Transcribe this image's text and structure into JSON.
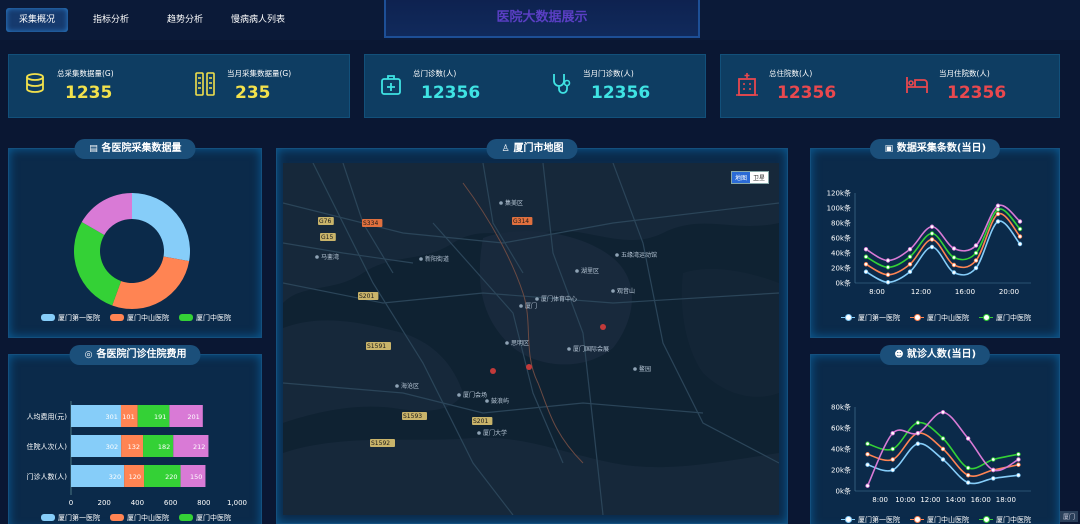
{
  "nav": {
    "tabs": [
      {
        "label": "采集概况",
        "active": true
      },
      {
        "label": "指标分析",
        "active": false
      },
      {
        "label": "趋势分析",
        "active": false
      },
      {
        "label": "慢病病人列表",
        "active": false
      }
    ],
    "title": "医院大数据展示"
  },
  "stats": [
    {
      "label": "总采集数据量(G)",
      "value": "1235",
      "color": "#f2e14c",
      "icon": "database-icon"
    },
    {
      "label": "当月采集数据量(G)",
      "value": "235",
      "color": "#f2e14c",
      "icon": "server-rack-icon"
    },
    {
      "label": "总门诊数(人)",
      "value": "12356",
      "color": "#3fe3e3",
      "icon": "medical-kit-icon"
    },
    {
      "label": "当月门诊数(人)",
      "value": "12356",
      "color": "#3fe3e3",
      "icon": "stethoscope-icon"
    },
    {
      "label": "总住院数(人)",
      "value": "12356",
      "color": "#e8484e",
      "icon": "hospital-building-icon"
    },
    {
      "label": "当月住院数(人)",
      "value": "12356",
      "color": "#e8484e",
      "icon": "hospital-bed-icon"
    }
  ],
  "panels": {
    "donut_title": "各医院采集数据量",
    "stack_title": "各医院门诊住院费用",
    "map_title": "厦门市地图",
    "collect_title": "数据采集条数(当日)",
    "visit_title": "就诊人数(当日)"
  },
  "map": {
    "toggle": [
      "地图",
      "卫星"
    ],
    "active_toggle": "地图",
    "places": [
      {
        "name": "集美区"
      },
      {
        "name": "湖里区"
      },
      {
        "name": "厦门"
      },
      {
        "name": "思明区"
      },
      {
        "name": "厦门大学"
      },
      {
        "name": "鼓浪屿"
      },
      {
        "name": "海沧区"
      },
      {
        "name": "五缘湾运动馆"
      },
      {
        "name": "观音山"
      },
      {
        "name": "厦门国际会展"
      },
      {
        "name": "鳌园"
      },
      {
        "name": "马銮湾"
      },
      {
        "name": "新阳街道"
      },
      {
        "name": "厦门体育中心"
      },
      {
        "name": "厦门会场"
      }
    ],
    "roads": [
      "G76",
      "G15",
      "S334",
      "G314",
      "S201",
      "S1591",
      "S1593",
      "S1592",
      "S201"
    ],
    "corner_tag": "厦门"
  },
  "colors": {
    "blue": "#86cdf9",
    "orange": "#ff8453",
    "green": "#34d136",
    "purple": "#d97ad6",
    "white": "#ffffff"
  },
  "chart_data": [
    {
      "type": "pie",
      "variant": "donut",
      "title": "各医院采集数据量",
      "labels": [
        "厦门第一医院",
        "厦门中山医院",
        "厦门中医院",
        ""
      ],
      "values": [
        25,
        25,
        25,
        15
      ],
      "colors": [
        "#86cdf9",
        "#ff8453",
        "#34d136",
        "#d97ad6"
      ],
      "legend": [
        "厦门第一医院",
        "厦门中山医院",
        "厦门中医院"
      ],
      "legend_placement": "bottom"
    },
    {
      "type": "bar",
      "orientation": "horizontal",
      "stacked": true,
      "title": "各医院门诊住院费用",
      "categories": [
        "人均费用(元)",
        "住院人次(人)",
        "门诊人数(人)"
      ],
      "series": [
        {
          "name": "厦门第一医院",
          "values": [
            301,
            302,
            320
          ],
          "color": "#86cdf9"
        },
        {
          "name": "厦门中山医院",
          "values": [
            101,
            132,
            120
          ],
          "color": "#ff8453"
        },
        {
          "name": "厦门中医院",
          "values": [
            191,
            182,
            220
          ],
          "color": "#34d136"
        },
        {
          "name": "",
          "values": [
            201,
            212,
            150
          ],
          "color": "#d97ad6"
        }
      ],
      "xticks": [
        "0",
        "200",
        "400",
        "600",
        "800",
        "1,000"
      ],
      "xlim": [
        0,
        1000
      ],
      "legend_placement": "bottom"
    },
    {
      "type": "line",
      "smooth": true,
      "title": "数据采集条数(当日)",
      "x": [
        7,
        9,
        11,
        13,
        15,
        17,
        19,
        21
      ],
      "xticks": [
        "8:00",
        "12:00",
        "16:00",
        "20:00"
      ],
      "xtick_values": [
        8,
        12,
        16,
        20
      ],
      "yticks": [
        "0k条",
        "20k条",
        "40k条",
        "60k条",
        "80k条",
        "100k条",
        "120k条"
      ],
      "ylim": [
        0,
        120000
      ],
      "series": [
        {
          "name": "厦门第一医院",
          "values": [
            15000,
            1000,
            15000,
            48000,
            14000,
            20000,
            82000,
            52000
          ],
          "color": "#86cdf9"
        },
        {
          "name": "厦门中山医院",
          "values": [
            25000,
            11000,
            25000,
            58000,
            24000,
            30000,
            92000,
            62000
          ],
          "color": "#ff8453"
        },
        {
          "name": "厦门中医院",
          "values": [
            35000,
            21000,
            35000,
            66000,
            34000,
            40000,
            98000,
            72000
          ],
          "color": "#34d136"
        },
        {
          "name": "",
          "values": [
            45000,
            30000,
            45000,
            75000,
            46000,
            50000,
            103000,
            82000
          ],
          "color": "#d97ad6"
        }
      ],
      "legend": [
        "厦门第一医院",
        "厦门中山医院",
        "厦门中医院"
      ],
      "legend_placement": "bottom"
    },
    {
      "type": "line",
      "smooth": true,
      "title": "就诊人数(当日)",
      "x": [
        7,
        9,
        11,
        13,
        15,
        17,
        19
      ],
      "xticks": [
        "8:00",
        "10:00",
        "12:00",
        "14:00",
        "16:00",
        "18:00"
      ],
      "xtick_values": [
        8,
        10,
        12,
        14,
        16,
        18
      ],
      "yticks": [
        "0k条",
        "20k条",
        "40k条",
        "60k条",
        "80k条"
      ],
      "ylim": [
        0,
        80000
      ],
      "series": [
        {
          "name": "厦门第一医院",
          "values": [
            25000,
            20000,
            45000,
            30000,
            8000,
            12000,
            15000
          ],
          "color": "#86cdf9"
        },
        {
          "name": "厦门中山医院",
          "values": [
            35000,
            30000,
            55000,
            40000,
            15000,
            20000,
            25000
          ],
          "color": "#ff8453"
        },
        {
          "name": "厦门中医院",
          "values": [
            45000,
            40000,
            65000,
            50000,
            22000,
            30000,
            35000
          ],
          "color": "#34d136"
        },
        {
          "name": "",
          "values": [
            5000,
            55000,
            55000,
            75000,
            50000,
            20000,
            30000
          ],
          "color": "#d97ad6"
        }
      ],
      "legend": [
        "厦门第一医院",
        "厦门中山医院",
        "厦门中医院"
      ],
      "legend_placement": "bottom"
    }
  ]
}
